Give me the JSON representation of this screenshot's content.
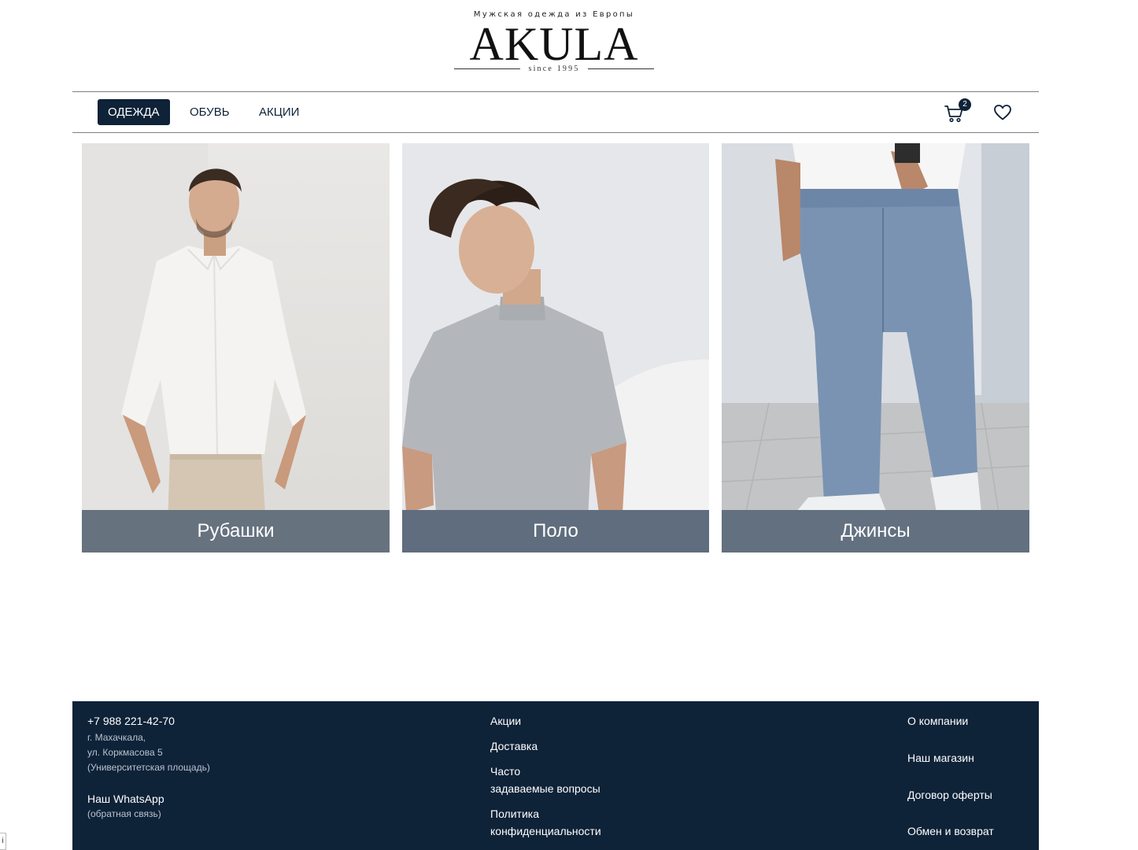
{
  "brand": {
    "tagline": "Мужская одежда из Европы",
    "name": "AKULA",
    "since": "since 1995"
  },
  "nav": {
    "items": [
      {
        "label": "ОДЕЖДА",
        "active": true
      },
      {
        "label": "ОБУВЬ",
        "active": false
      },
      {
        "label": "АКЦИИ",
        "active": false
      }
    ],
    "cart_icon": "cart-icon",
    "cart_count": "2",
    "favorites_icon": "heart-icon"
  },
  "categories": [
    {
      "label": "Рубашки"
    },
    {
      "label": "Поло"
    },
    {
      "label": "Джинсы"
    }
  ],
  "footer": {
    "phone": "+7 988 221-42-70",
    "address_lines": [
      "г. Махачкала,",
      "ул. Коркмасова 5",
      "(Университетская площадь)"
    ],
    "whatsapp": "Наш WhatsApp",
    "whatsapp_note": "(обратная связь)",
    "links_middle": [
      {
        "label": "Акции"
      },
      {
        "label": "Доставка"
      },
      {
        "label_lines": [
          "Часто",
          "задаваемые вопросы"
        ]
      },
      {
        "label_lines": [
          "Политика",
          "конфиденциальности"
        ]
      }
    ],
    "links_right": [
      {
        "label": "О компании"
      },
      {
        "label": "Наш магазин"
      },
      {
        "label": "Договор оферты"
      },
      {
        "label": "Обмен и возврат"
      }
    ]
  },
  "colors": {
    "navy": "#0e2238",
    "caption_overlay": "#48596c",
    "divider": "#7b7f86"
  }
}
